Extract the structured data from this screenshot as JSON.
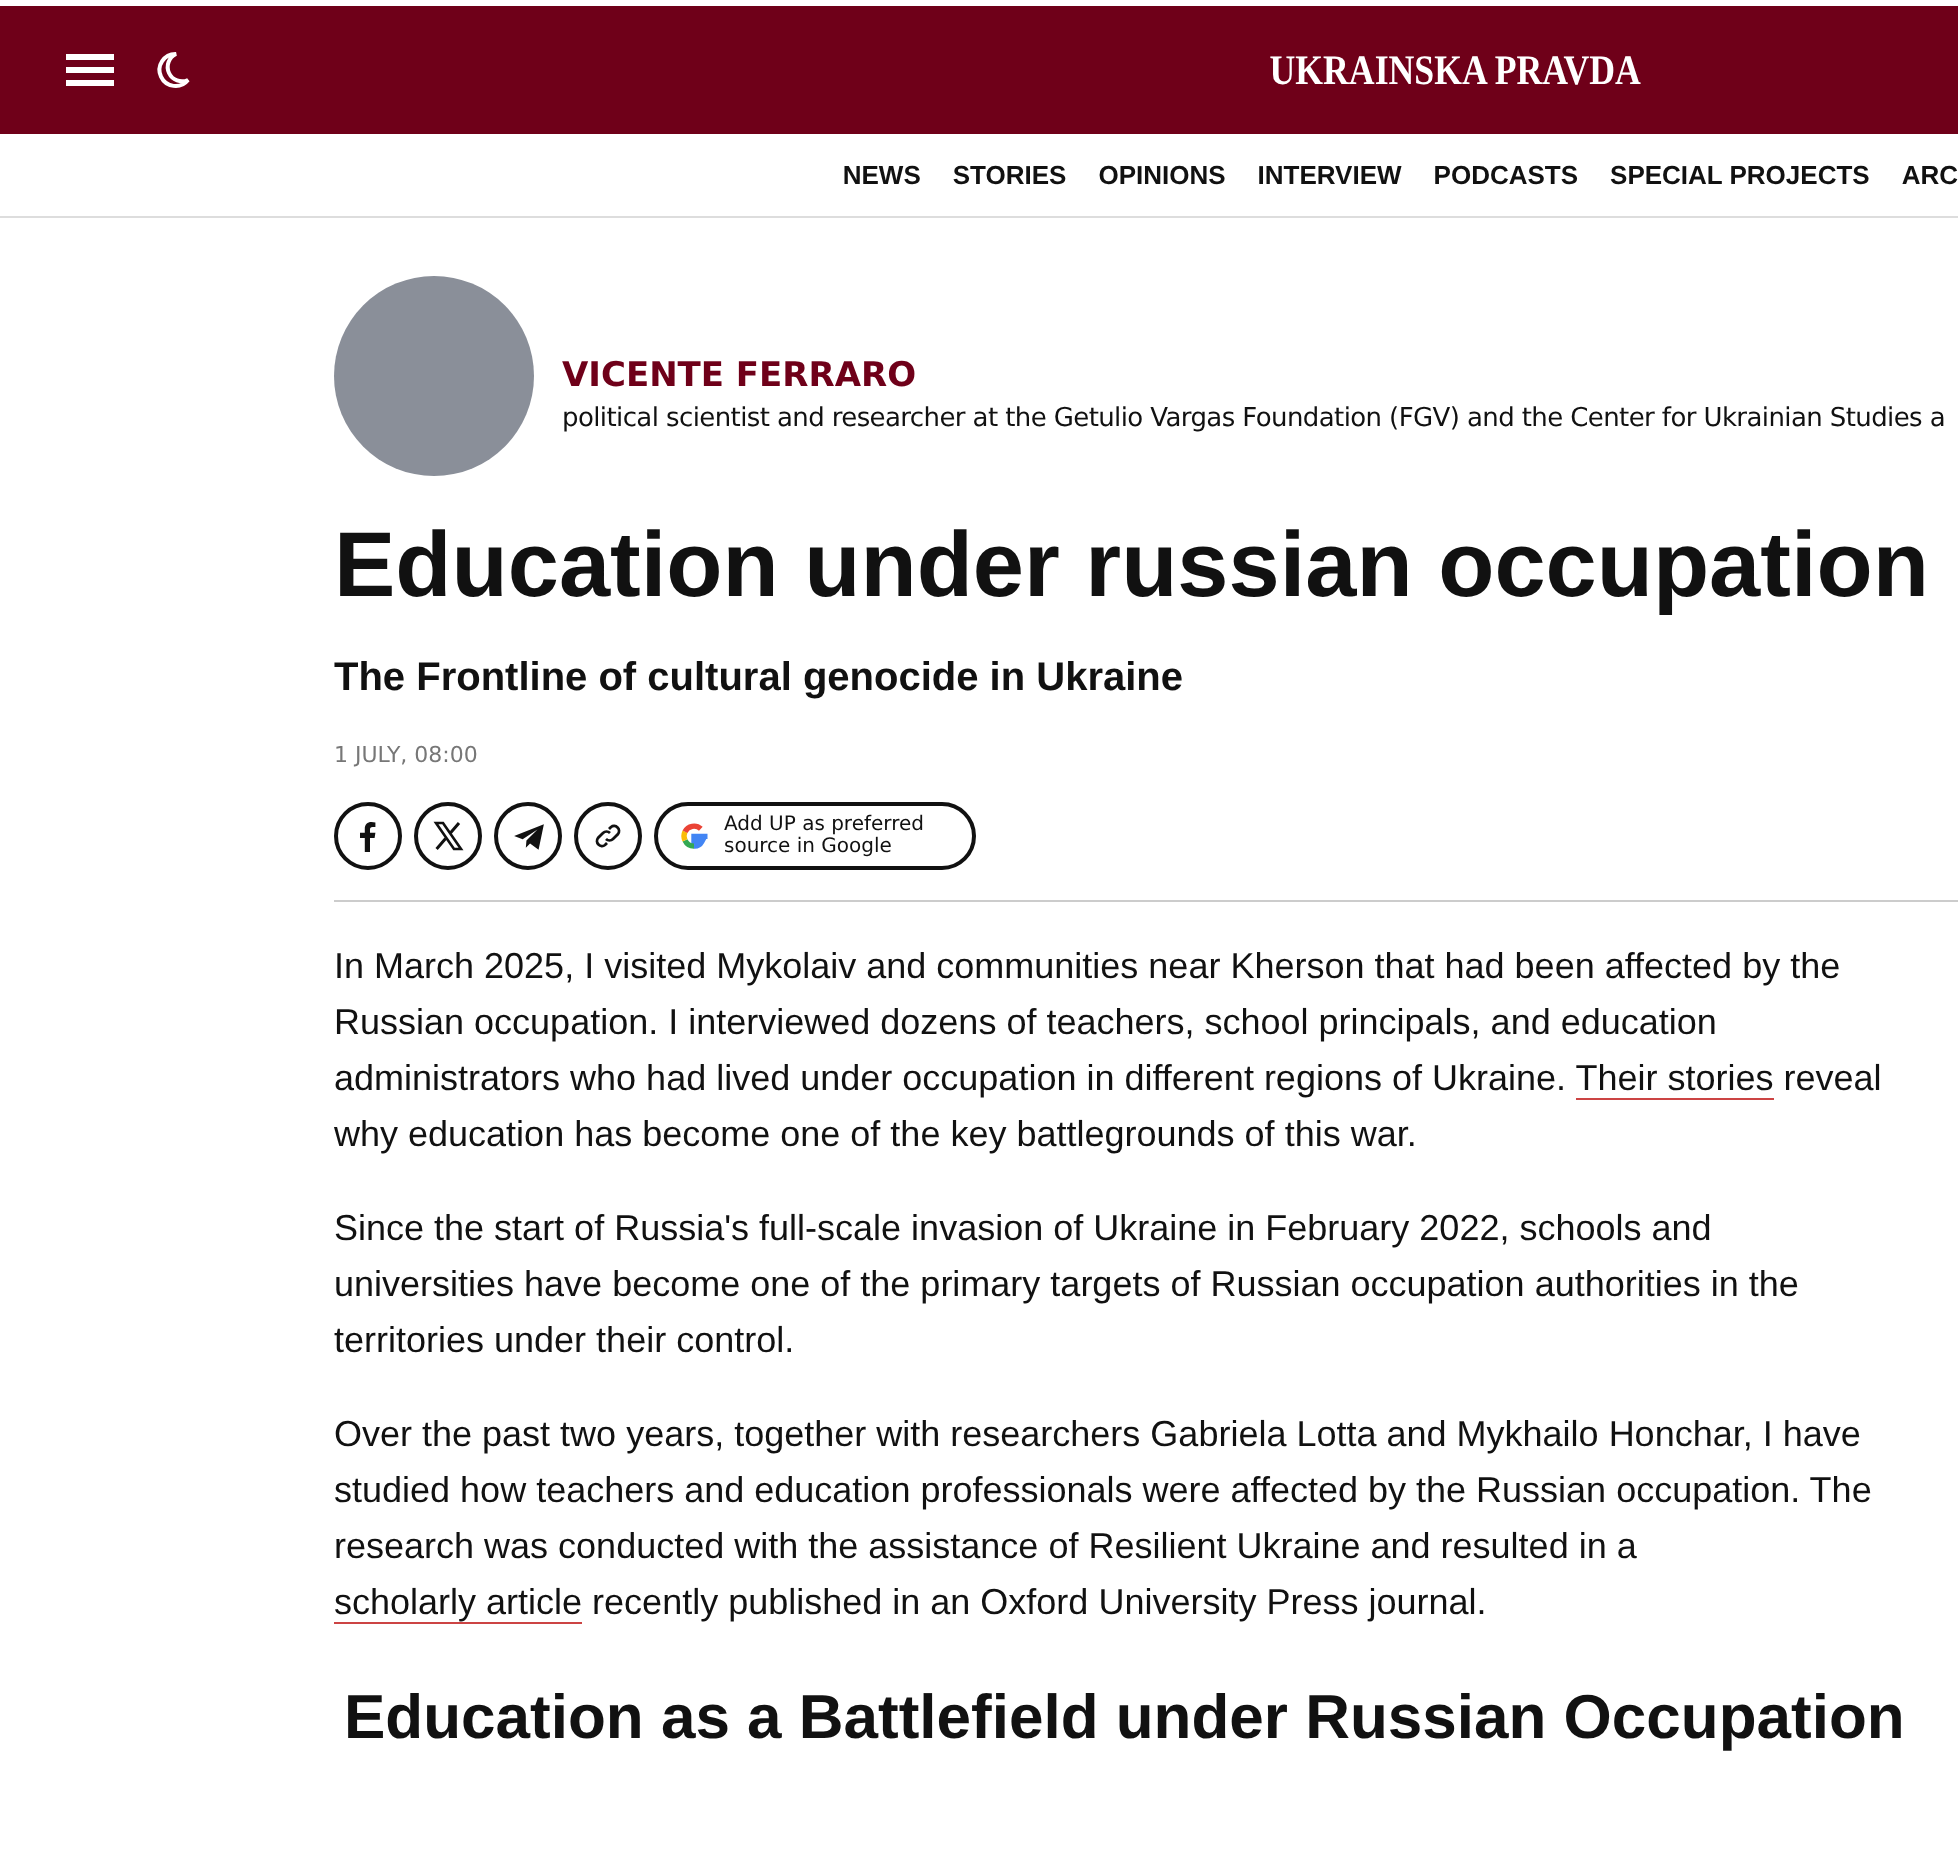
{
  "header": {
    "logo": "UKRAINSKA PRAVDA"
  },
  "nav": [
    "NEWS",
    "STORIES",
    "OPINIONS",
    "INTERVIEW",
    "PODCASTS",
    "SPECIAL PROJECTS",
    "ARC"
  ],
  "author": {
    "name": "VICENTE FERRARO",
    "bio": "political scientist and researcher at the Getulio Vargas Foundation (FGV) and the Center for Ukrainian Studies a"
  },
  "article": {
    "title": "Education under russian occupation",
    "subtitle": "The Frontline of cultural genocide in Ukraine",
    "date": "1 JULY, 08:00",
    "share": [
      {
        "kind": "facebook"
      },
      {
        "kind": "x"
      },
      {
        "kind": "telegram"
      },
      {
        "kind": "link"
      }
    ],
    "google_button": "Add UP as preferred source in Google",
    "paragraphs": [
      [
        {
          "kind": "text",
          "text": "In March 2025, I visited Mykolaiv and communities near Kherson that had been affected by the Russian occupation. I interviewed dozens of teachers, school principals, and education administrators who had lived under occupation in different regions of Ukraine. "
        },
        {
          "kind": "link",
          "text": "Their stories"
        },
        {
          "kind": "text",
          "text": " reveal why education has become one of the key battlegrounds of this war."
        }
      ],
      [
        {
          "kind": "text",
          "text": "Since the start of Russia's full-scale invasion of Ukraine in February 2022, schools and universities have become one of the primary targets of Russian occupation authorities in the territories under their control."
        }
      ],
      [
        {
          "kind": "text",
          "text": "Over the past two years, together with researchers Gabriela Lotta and Mykhailo Honchar, I have studied how teachers and education professionals were affected by the Russian occupation. The research was conducted with the assistance of Resilient Ukraine and resulted in a "
        },
        {
          "kind": "link",
          "text": "scholarly article"
        },
        {
          "kind": "text",
          "text": " recently published in an Oxford University Press journal."
        }
      ]
    ],
    "section_heading": "Education as a Battlefield under Russian Occupation"
  }
}
